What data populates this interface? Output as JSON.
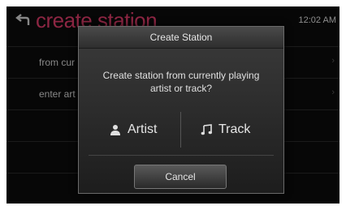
{
  "header": {
    "title": "create station",
    "clock": "12:02 AM"
  },
  "list": {
    "items": [
      {
        "label": "from cur"
      },
      {
        "label": "enter art"
      }
    ]
  },
  "dialog": {
    "title": "Create Station",
    "message_line1": "Create station from currently playing",
    "message_line2": "artist or track?",
    "artist_label": "Artist",
    "track_label": "Track",
    "cancel_label": "Cancel"
  },
  "colors": {
    "title": "#d93b68",
    "background": "#0b0b0b"
  },
  "icons": {
    "back": "back-arrow-icon",
    "artist": "person-icon",
    "track": "music-note-icon"
  }
}
